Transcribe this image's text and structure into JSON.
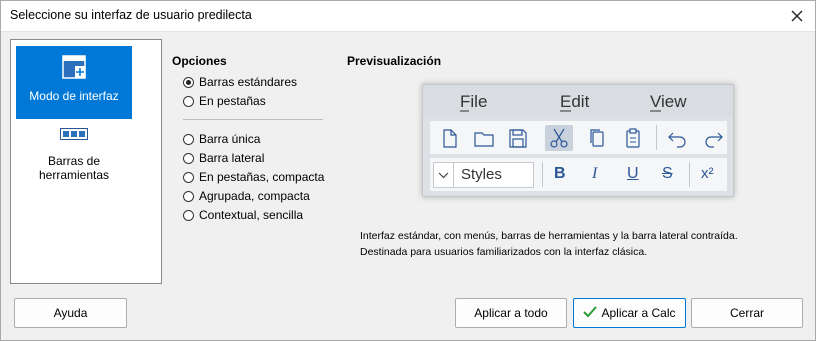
{
  "window": {
    "title": "Seleccione su interfaz de usuario predilecta"
  },
  "sidebar": {
    "items": [
      {
        "label": "Modo de interfaz",
        "selected": true,
        "icon": "interface-mode-icon"
      },
      {
        "label": "Barras de herramientas",
        "selected": false,
        "icon": "toolbars-icon"
      }
    ]
  },
  "options": {
    "title": "Opciones",
    "group1": [
      {
        "label": "Barras estándares",
        "checked": true
      },
      {
        "label": "En pestañas",
        "checked": false
      }
    ],
    "group2": [
      {
        "label": "Barra única",
        "checked": false
      },
      {
        "label": "Barra lateral",
        "checked": false
      },
      {
        "label": "En pestañas, compacta",
        "checked": false
      },
      {
        "label": "Agrupada, compacta",
        "checked": false
      },
      {
        "label": "Contextual, sencilla",
        "checked": false
      }
    ]
  },
  "preview": {
    "title": "Previsualización",
    "menus": [
      "File",
      "Edit",
      "View"
    ],
    "style_box": "Styles",
    "format_buttons": [
      "B",
      "I",
      "U",
      "S",
      "x²"
    ]
  },
  "description": {
    "line1": "Interfaz estándar, con menús, barras de herramientas y la barra lateral contraída.",
    "line2": "Destinada para usuarios familiarizados con la interfaz clásica."
  },
  "buttons": {
    "help": "Ayuda",
    "apply_all": "Aplicar a todo",
    "apply_calc": "Aplicar a Calc",
    "close": "Cerrar"
  },
  "colors": {
    "accent": "#0078d7",
    "apply_check": "#2e9b3a"
  }
}
